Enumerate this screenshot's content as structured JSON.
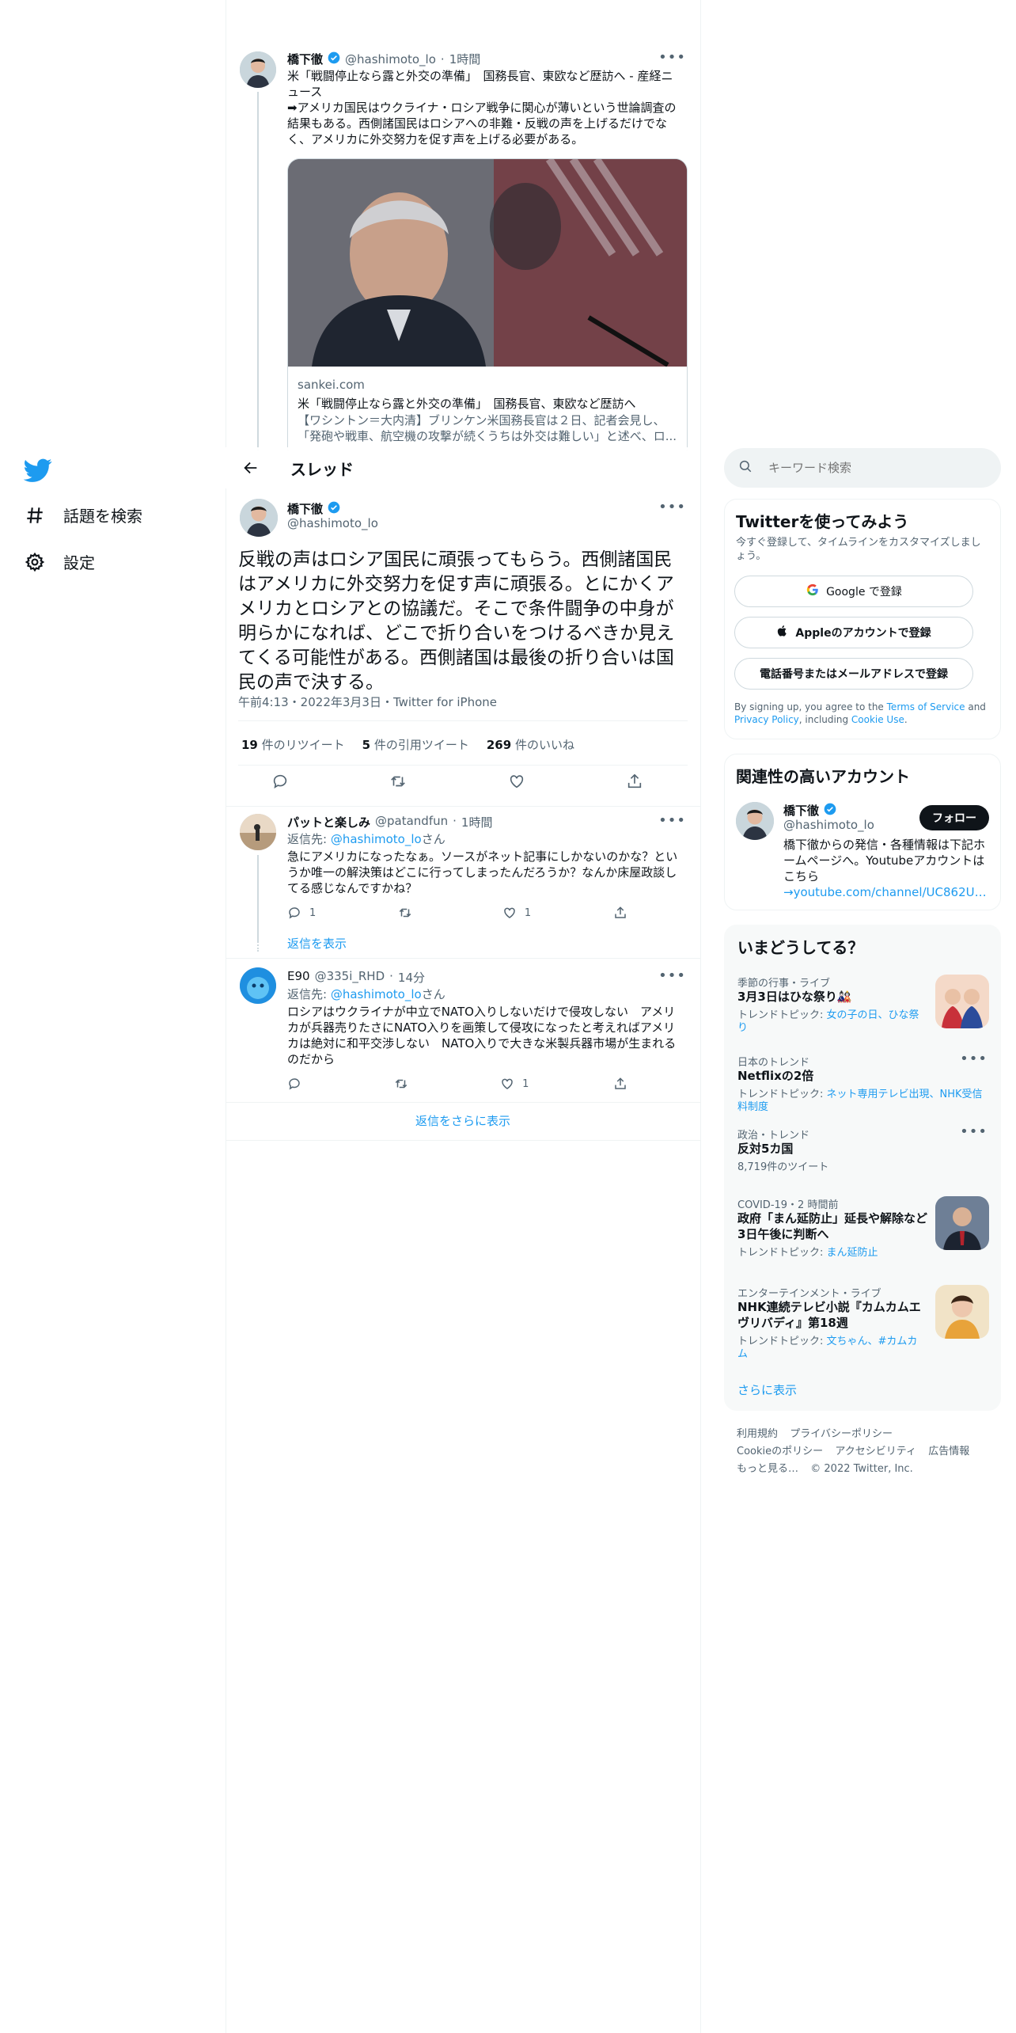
{
  "nav": {
    "items": [
      {
        "label": "話題を検索"
      },
      {
        "label": "設定"
      }
    ]
  },
  "prev_tweet": {
    "name": "橋下徹",
    "handle": "@hashimoto_lo",
    "time": "1時間",
    "text_line1": "米「戦闘停止なら露と外交の準備」　国務長官、東欧など歴訪へ - 産経ニュース",
    "text_body": "➡アメリカ国民はウクライナ・ロシア戦争に関心が薄いという世論調査の結果もある。西側諸国民はロシアへの非難・反戦の声を上げるだけでなく、アメリカに外交努力を促す声を上げる必要がある。",
    "card": {
      "domain": "sankei.com",
      "title": "米「戦闘停止なら露と外交の準備」　国務長官、東欧など歴訪へ",
      "desc": "【ワシントン＝大内清】ブリンケン米国務長官は２日、記者会見し、「発砲や戦車、航空機の攻撃が続くうちは外交は難しい」と述べ、ロ..."
    }
  },
  "header": {
    "title": "スレッド"
  },
  "main_tweet": {
    "name": "橋下徹",
    "handle": "@hashimoto_lo",
    "text": "反戦の声はロシア国民に頑張ってもらう。西側諸国民はアメリカに外交努力を促す声に頑張る。とにかくアメリカとロシアとの協議だ。そこで条件闘争の中身が明らかになれば、どこで折り合いをつけるべきか見えてくる可能性がある。西側諸国は最後の折り合いは国民の声で決する。",
    "meta": "午前4:13・2022年3月3日・Twitter for iPhone",
    "stats": {
      "retweets_num": "19",
      "retweets_label": " 件のリツイート",
      "quotes_num": "5",
      "quotes_label": " 件の引用ツイート",
      "likes_num": "269",
      "likes_label": " 件のいいね"
    }
  },
  "replies": [
    {
      "name": "パットと楽しみ",
      "handle": "@patandfun",
      "time": "1時間",
      "reply_to_prefix": "返信先: ",
      "reply_to_handle": "@hashimoto_lo",
      "reply_to_suffix": "さん",
      "text": "急にアメリカになったなぁ。ソースがネット記事にしかないのかな？というか唯一の解決策はどこに行ってしまったんだろうか？なんか床屋政談してる感じなんですかね？",
      "replies": "1",
      "retweets": "",
      "likes": "1",
      "show_replies": "返信を表示"
    },
    {
      "name": "E90",
      "handle": "@335i_RHD",
      "time": "14分",
      "reply_to_prefix": "返信先: ",
      "reply_to_handle": "@hashimoto_lo",
      "reply_to_suffix": "さん",
      "text": "ロシアはウクライナが中立でNATO入りしないだけで侵攻しない　アメリカが兵器売りたさにNATO入りを画策して侵攻になったと考えればアメリカは絶対に和平交渉しない　NATO入りで大きな米製兵器市場が生まれるのだから",
      "replies": "",
      "retweets": "",
      "likes": "1"
    }
  ],
  "show_more_replies": "返信をさらに表示",
  "search": {
    "placeholder": "キーワード検索"
  },
  "signup": {
    "title": "Twitterを使ってみよう",
    "subtitle": "今すぐ登録して、タイムラインをカスタマイズしましょう。",
    "google": "Google で登録",
    "apple": "Appleのアカウントで登録",
    "phone": "電話番号またはメールアドレスで登録",
    "legal_1": "By signing up, you agree to the ",
    "legal_tos": "Terms of Service",
    "legal_2": " and ",
    "legal_pp": "Privacy Policy",
    "legal_3": ", including ",
    "legal_cookie": "Cookie Use",
    "legal_4": "."
  },
  "relevant": {
    "title": "関連性の高いアカウント",
    "name": "橋下徹",
    "handle": "@hashimoto_lo",
    "follow": "フォロー",
    "bio": "橋下徹からの発信・各種情報は下記ホームページへ。Youtubeアカウントはこちら",
    "bio_link": "→youtube.com/channel/UC862U…"
  },
  "trends": {
    "title": "いまどうしてる？",
    "items": [
      {
        "context": "季節の行事・ライブ",
        "title": "3月3日はひな祭り🎎",
        "sub_prefix": "トレンドトピック: ",
        "sub_link": "女の子の日、ひな祭り"
      },
      {
        "context": "日本のトレンド",
        "title": "Netflixの2倍",
        "sub_prefix": "トレンドトピック: ",
        "sub_link": "ネット専用テレビ出現、NHK受信料制度"
      },
      {
        "context": "政治・トレンド",
        "title": "反対5カ国",
        "sub_prefix": "8,719件のツイート",
        "sub_link": ""
      },
      {
        "context": "COVID-19・2 時間前",
        "title": "政府「まん延防止」延長や解除など3日午後に判断へ",
        "sub_prefix": "トレンドトピック: ",
        "sub_link": "まん延防止"
      },
      {
        "context": "エンターテインメント・ライブ",
        "title": "NHK連続テレビ小説『カムカムエヴリバディ』第18週",
        "sub_prefix": "トレンドトピック: ",
        "sub_link": "文ちゃん、#カムカム"
      }
    ],
    "show_more": "さらに表示"
  },
  "footer": {
    "links": [
      "利用規約",
      "プライバシーポリシー",
      "Cookieのポリシー",
      "アクセシビリティ",
      "広告情報",
      "もっと見る…"
    ],
    "copyright": "© 2022 Twitter, Inc."
  },
  "colors": {
    "accent": "#1d9bf0",
    "text": "#0f1419",
    "muted": "#536471",
    "border": "#eff3f4"
  }
}
